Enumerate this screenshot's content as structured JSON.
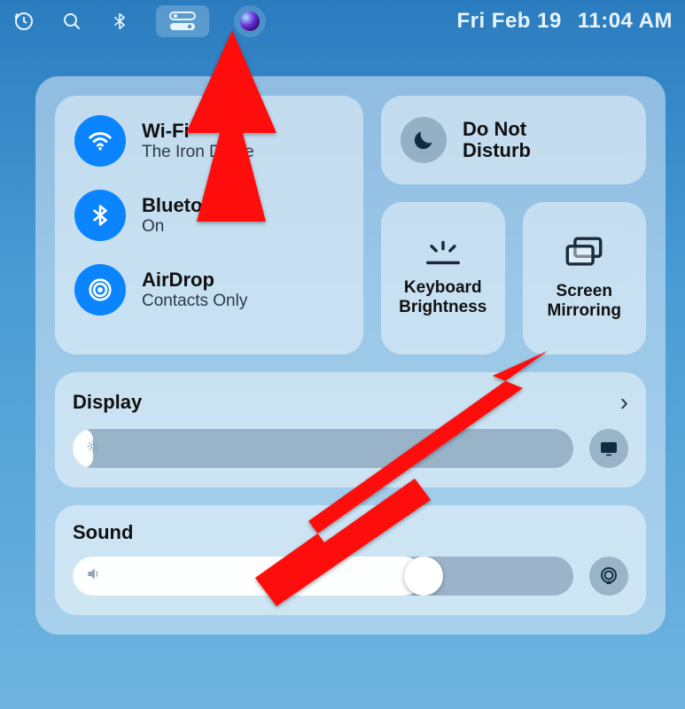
{
  "menubar": {
    "date": "Fri Feb 19",
    "time": "11:04 AM"
  },
  "connectivity": {
    "wifi": {
      "title": "Wi-Fi",
      "subtitle": "The Iron Dome"
    },
    "bluetooth": {
      "title": "Bluetooth",
      "subtitle": "On"
    },
    "airdrop": {
      "title": "AirDrop",
      "subtitle": "Contacts Only"
    }
  },
  "dnd": {
    "label_line1": "Do Not",
    "label_line2": "Disturb"
  },
  "mini": {
    "keyboard_brightness": {
      "label_line1": "Keyboard",
      "label_line2": "Brightness"
    },
    "screen_mirroring": {
      "label_line1": "Screen",
      "label_line2": "Mirroring"
    }
  },
  "display": {
    "heading": "Display",
    "value_percent": 4
  },
  "sound": {
    "heading": "Sound",
    "value_percent": 70
  }
}
